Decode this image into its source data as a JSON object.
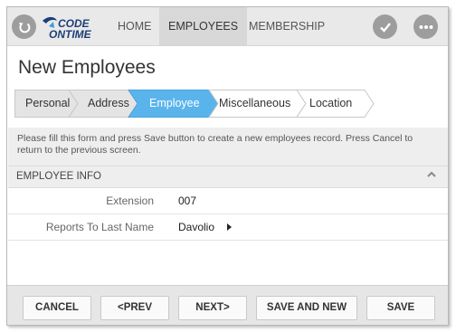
{
  "nav": {
    "logo_line1": "CODE",
    "logo_line2": "ONTIME",
    "items": [
      {
        "label": "HOME",
        "active": false
      },
      {
        "label": "EMPLOYEES",
        "active": true
      },
      {
        "label": "MEMBERSHIP",
        "active": false
      }
    ],
    "icons": {
      "back": "back-arrow-icon",
      "check": "checkmark-icon",
      "more": "more-ellipsis-icon"
    }
  },
  "page": {
    "title": "New Employees"
  },
  "wizard": {
    "steps": [
      {
        "label": "Personal",
        "active": false
      },
      {
        "label": "Address",
        "active": false
      },
      {
        "label": "Employee",
        "active": true
      },
      {
        "label": "Miscellaneous",
        "active": false
      },
      {
        "label": "Location",
        "active": false
      }
    ]
  },
  "description": "Please fill this form and press Save button to create a new employees record. Press Cancel to return to the previous screen.",
  "section": {
    "title": "EMPLOYEE INFO",
    "icon": "chevron-up-icon"
  },
  "fields": [
    {
      "label": "Extension",
      "value": "007"
    },
    {
      "label": "Reports To Last Name",
      "value": "Davolio"
    }
  ],
  "toolbar": {
    "cancel": "CANCEL",
    "prev": "PREV",
    "next": "NEXT",
    "save_and_new": "SAVE AND NEW",
    "save": "SAVE"
  },
  "colors": {
    "accent": "#5ab4ec",
    "topbar": "#e9e9e9",
    "icon_gray": "#9d9d9d"
  }
}
